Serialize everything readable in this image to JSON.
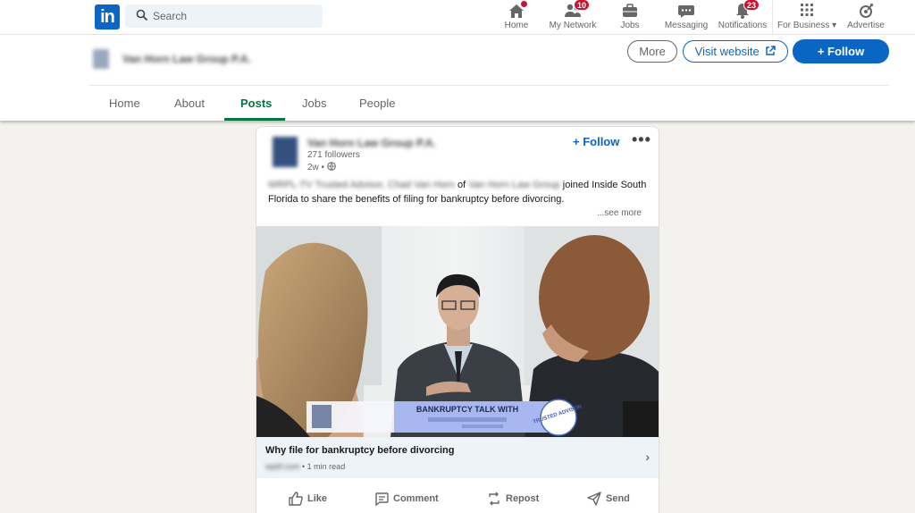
{
  "topnav": {
    "search_placeholder": "Search",
    "items": [
      {
        "label": "Home",
        "badge": ""
      },
      {
        "label": "My Network",
        "badge": "10"
      },
      {
        "label": "Jobs",
        "badge": ""
      },
      {
        "label": "Messaging",
        "badge": ""
      },
      {
        "label": "Notifications",
        "badge": "23"
      },
      {
        "label": "For Business",
        "badge": ""
      },
      {
        "label": "Advertise",
        "badge": ""
      }
    ]
  },
  "company": {
    "name": "Van Horn Law Group P.A.",
    "more_label": "More",
    "visit_label": "Visit website",
    "follow_label": "+ Follow",
    "tabs": [
      "Home",
      "About",
      "Posts",
      "Jobs",
      "People"
    ],
    "active_tab": "Posts"
  },
  "post": {
    "author": "Van Horn Law Group P.A.",
    "followers": "271 followers",
    "time": "2w •",
    "follow_label": "+ Follow",
    "menu": "•••",
    "text_blurred_a": "WRPL-TV Trusted Advisor, Chad Van Horn",
    "text_of": " of ",
    "text_blurred_b": "Van Horn Law Group",
    "text_rest": " joined Inside South Florida to share the benefits of filing for bankruptcy before divorcing.",
    "see_more": "...see more",
    "image_banner": "BANKRUPTCY TALK WITH",
    "image_badge": "TRUSTED ADVISOR",
    "link_title": "Why file for bankruptcy before divorcing",
    "link_source_blurred": "wpbf.com",
    "link_meta": "1 min read",
    "actions": [
      "Like",
      "Comment",
      "Repost",
      "Send"
    ]
  },
  "colors": {
    "brand": "#0a66c2",
    "active_tab": "#057642",
    "badge": "#cb112d"
  }
}
